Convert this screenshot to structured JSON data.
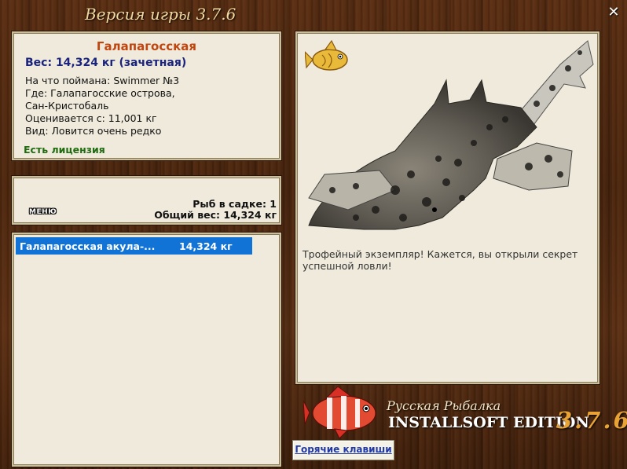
{
  "window": {
    "game_version": "Версия игры 3.7.6",
    "close_glyph": "✕"
  },
  "fish_info": {
    "name": "Галапагосская",
    "weight_line": "Вес: 14,324 кг (зачетная)",
    "caught_on": "На что поймана: Swimmer №3",
    "where_line1": "Где: Галапагосские острова,",
    "where_line2": "Сан-Кристобаль",
    "valued_from": "Оценивается с: 11,001 кг",
    "species_note": "Вид: Ловится очень редко",
    "license": "Есть лицензия"
  },
  "catch_stats": {
    "menu_label": "МЕНЮ",
    "fish_in_keepnet": "Рыб в садке: 1",
    "total_weight": "Общий вес: 14,324 кг"
  },
  "catch_list": {
    "items": [
      {
        "name": "Галапагосская акула-...",
        "weight": "14,324 кг",
        "selected": true
      }
    ]
  },
  "photo": {
    "trophy_text": "Трофейный экземпляр! Кажется, вы открыли секрет успешной ловли!",
    "badge_icon": "golden-fish-trophy-icon"
  },
  "branding": {
    "line1": "Русская Рыбалка",
    "line2": "INSTALLSOFT EDITION",
    "version": "3.7.6"
  },
  "hotkeys_label": "Горячие клавиши",
  "colors": {
    "wood_background": "#4e2710",
    "panel_bg": "#efeadb",
    "fish_name": "#c0450f",
    "weight_text": "#1a237e",
    "license_text": "#1f6b10",
    "list_selection": "#1273d6",
    "version_accent": "#e8a334"
  }
}
